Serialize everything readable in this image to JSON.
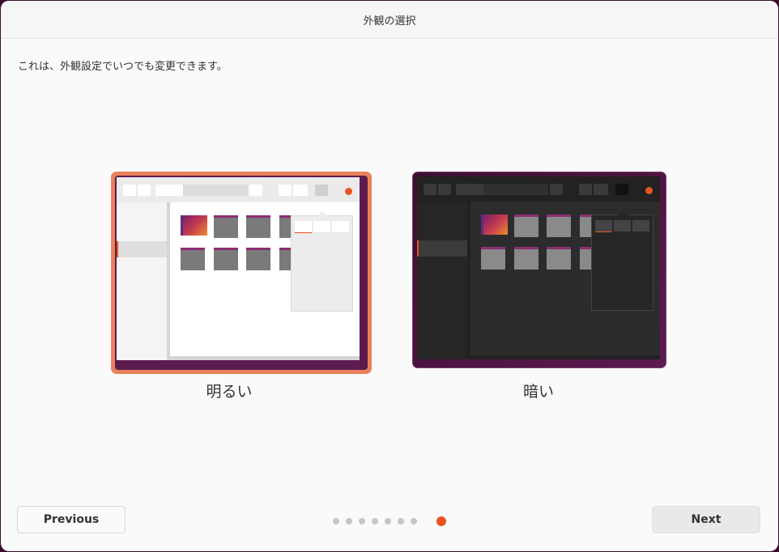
{
  "window": {
    "title": "外観の選択"
  },
  "description": "これは、外観設定でいつでも変更できます。",
  "choices": [
    {
      "label": "明るい",
      "selected": true
    },
    {
      "label": "暗い",
      "selected": false
    }
  ],
  "footer": {
    "previous_label": "Previous",
    "next_label": "Next",
    "steps_total": 8,
    "current_step": 8
  },
  "colors": {
    "accent": "#e95420",
    "selection_border": "#e9825a",
    "wallpaper": "#5c1b4f"
  }
}
